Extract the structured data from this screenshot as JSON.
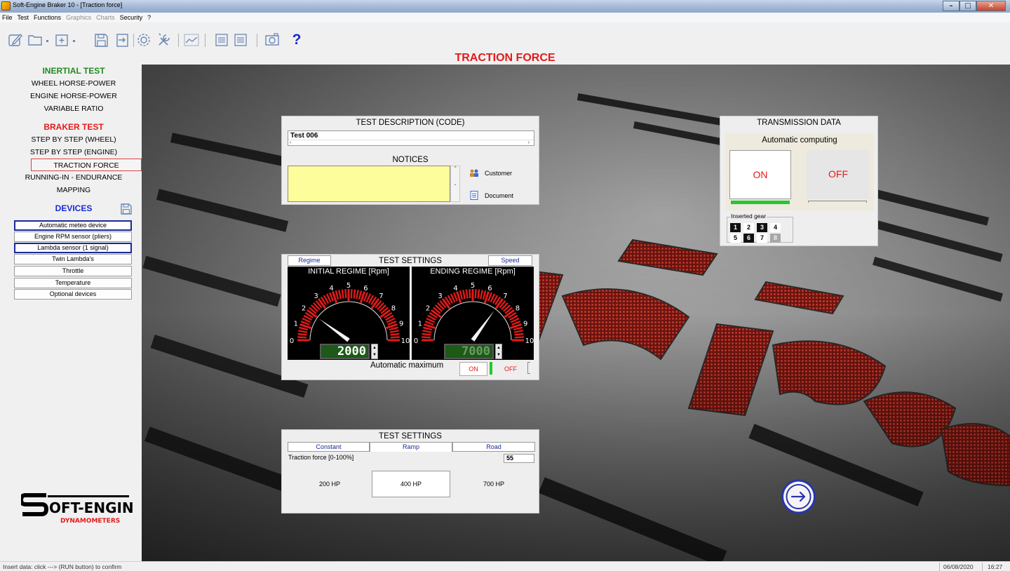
{
  "window": {
    "title": "Soft-Engine Braker 10 - [Traction force]"
  },
  "menu": {
    "items": [
      {
        "label": "File",
        "enabled": true
      },
      {
        "label": "Test",
        "enabled": true
      },
      {
        "label": "Functions",
        "enabled": true
      },
      {
        "label": "Graphics",
        "enabled": false
      },
      {
        "label": "Charts",
        "enabled": false
      },
      {
        "label": "Security",
        "enabled": true
      },
      {
        "label": "?",
        "enabled": true
      }
    ]
  },
  "toolbar": {
    "icons": [
      "edit-icon",
      "folder-icon",
      "dropdown-icon",
      "add-file-icon",
      "dropdown-icon",
      "save-icon",
      "import-icon",
      "settings-icon",
      "tools-icon",
      "chart-icon",
      "list-icon",
      "list-icon",
      "camera-icon",
      "help-icon"
    ],
    "help_label": "?"
  },
  "page_title": "TRACTION FORCE",
  "sidebar": {
    "inertial_head": "INERTIAL TEST",
    "inertial_items": [
      "WHEEL HORSE-POWER",
      "ENGINE HORSE-POWER",
      "VARIABLE RATIO"
    ],
    "braker_head": "BRAKER TEST",
    "braker_items": [
      "STEP BY STEP (WHEEL)",
      "STEP BY STEP (ENGINE)",
      "TRACTION FORCE",
      "RUNNING-IN - ENDURANCE",
      "MAPPING"
    ],
    "active_item": "TRACTION FORCE",
    "devices_head": "DEVICES",
    "devices": [
      {
        "label": "Automatic meteo device",
        "highlighted": true
      },
      {
        "label": "Engine RPM sensor (pliers)",
        "highlighted": false
      },
      {
        "label": "Lambda sensor (1 signal)",
        "highlighted": true
      },
      {
        "label": "Twin Lambda's",
        "highlighted": false
      },
      {
        "label": "Throttle",
        "highlighted": false
      },
      {
        "label": "Temperature",
        "highlighted": false
      },
      {
        "label": "Optional devices",
        "highlighted": false
      }
    ],
    "logo_text": "OFT-ENGINE",
    "logo_sub": "DYNAMOMETERS"
  },
  "description": {
    "title": "TEST DESCRIPTION (CODE)",
    "code_value": "Test 006",
    "notices_title": "NOTICES",
    "notices_value": "",
    "customer_label": "Customer",
    "document_label": "Document"
  },
  "transmission": {
    "title": "TRANSMISSION DATA",
    "auto_label": "Automatic computing",
    "on_label": "ON",
    "off_label": "OFF",
    "auto_state": "ON",
    "gear_legend": "Inserted gear",
    "gears": [
      {
        "label": "1",
        "state": "on"
      },
      {
        "label": "2",
        "state": "off"
      },
      {
        "label": "3",
        "state": "on"
      },
      {
        "label": "4",
        "state": "off"
      },
      {
        "label": "5",
        "state": "off"
      },
      {
        "label": "6",
        "state": "on"
      },
      {
        "label": "7",
        "state": "off"
      },
      {
        "label": "8",
        "state": "disabled"
      }
    ]
  },
  "test_settings_1": {
    "title": "TEST SETTINGS",
    "tab_left": "Regime",
    "tab_right": "Speed",
    "initial": {
      "title": "INITIAL REGIME [Rpm]",
      "value": "2000",
      "needle_value": 2.0
    },
    "ending": {
      "title": "ENDING REGIME [Rpm]",
      "value": "7000",
      "needle_value": 7.0
    },
    "gauge_ticks": [
      "0",
      "1",
      "2",
      "3",
      "4",
      "5",
      "6",
      "7",
      "8",
      "9",
      "10"
    ],
    "auto_max_label": "Automatic maximum",
    "on_label": "ON",
    "off_label": "OFF",
    "auto_max_state": "ON"
  },
  "test_settings_2": {
    "title": "TEST SETTINGS",
    "modes": [
      "Constant",
      "Ramp",
      "Road"
    ],
    "selected_mode": "Ramp",
    "traction_label": "Traction force [0-100%]",
    "traction_value": "55",
    "hp_options": [
      "200 HP",
      "400 HP",
      "700 HP"
    ],
    "selected_hp": "400 HP"
  },
  "status": {
    "text": "Insert data: click ---> (RUN button) to confirm",
    "date": "06/08/2020",
    "time": "16:27"
  }
}
